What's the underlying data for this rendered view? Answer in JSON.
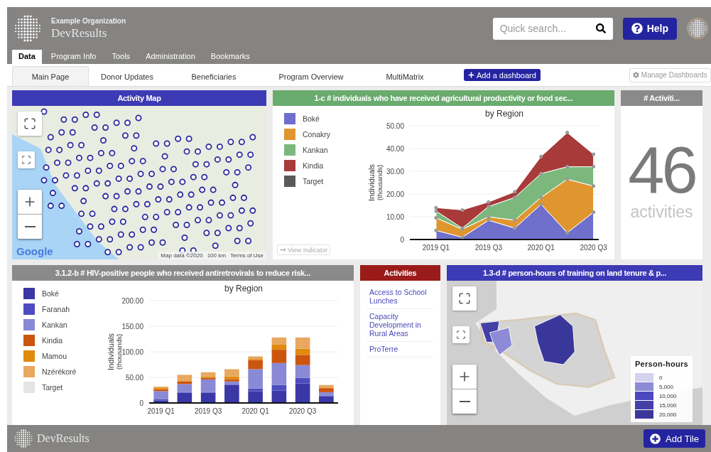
{
  "header": {
    "organization": "Example Organization",
    "app_name": "DevResults",
    "search": {
      "placeholder": "Quick search..."
    },
    "help_button": "Help"
  },
  "nav_tabs": [
    {
      "label": "Data",
      "selected": true
    },
    {
      "label": "Program Info",
      "selected": false
    },
    {
      "label": "Tools",
      "selected": false
    },
    {
      "label": "Administration",
      "selected": false
    },
    {
      "label": "Bookmarks",
      "selected": false
    }
  ],
  "dashboard_tabs": [
    {
      "label": "Main Page",
      "selected": true
    },
    {
      "label": "Donor Updates",
      "selected": false
    },
    {
      "label": "Beneficiaries",
      "selected": false
    },
    {
      "label": "Program Overview",
      "selected": false
    },
    {
      "label": "MultiMatrix",
      "selected": false
    }
  ],
  "add_dashboard_button": "Add a dashboard",
  "manage_dashboards_button": "Manage Dashboards",
  "rows": [
    {
      "tiles": [
        {
          "kind": "map",
          "title": "Activity Map",
          "color": "#3d3ab5",
          "logo": "Google",
          "attributions": [
            "Map data ©2020",
            "100 km",
            "Terms of Use"
          ]
        },
        {
          "kind": "chart",
          "title": "1-c # individuals who have received agricultural productivity or food sec...",
          "color": "#6aab6e",
          "view_indicator": "View Indicator",
          "chart_data": {
            "type": "area",
            "title": "by Region",
            "ylabel": "Individuals $_{(thousands)}$",
            "stacked": true,
            "grid": true,
            "categories": [
              "2019 Q1",
              null,
              "2019 Q3",
              null,
              "2020 Q1",
              null,
              "2020 Q3"
            ],
            "ylim": [
              0,
              50
            ],
            "yticks": [
              {
                "value": 0,
                "label": "0"
              },
              {
                "value": 10,
                "label": "10.00"
              },
              {
                "value": 20,
                "label": "20.00"
              },
              {
                "value": 30,
                "label": "30.00"
              },
              {
                "value": 40,
                "label": "40.00"
              },
              {
                "value": 50,
                "label": "50.00"
              }
            ],
            "series": [
              {
                "name": "Boké",
                "color": "#6f6fcc",
                "values": [
                  4,
                  1,
                  8.5,
                  5,
                  15.5,
                  3,
                  12
                ]
              },
              {
                "name": "Conakry",
                "color": "#e0962e",
                "values": [
                  5.5,
                  3.5,
                  1.5,
                  3.5,
                  3,
                  23.5,
                  11.5
                ]
              },
              {
                "name": "Kankan",
                "color": "#7cb87c",
                "values": [
                  3,
                  0.5,
                  4.5,
                  10,
                  10.5,
                  5.5,
                  8.5
                ]
              },
              {
                "name": "Kindia",
                "color": "#a83a3a",
                "values": [
                  1.5,
                  8,
                  2,
                  2.5,
                  7.5,
                  15,
                  5.5
                ]
              },
              {
                "name": "Target",
                "color": "#5a5a5a",
                "values": [
                  null,
                  null,
                  null,
                  null,
                  null,
                  null,
                  null
                ]
              }
            ]
          }
        },
        {
          "kind": "count",
          "title": "# Activiti...",
          "color": "#8a8a8a",
          "value": "46",
          "unit": "activities"
        }
      ]
    },
    {
      "tiles": [
        {
          "kind": "chart",
          "title": "3.1.2-b # HIV-positive people who received antiretrovirals to reduce risk...",
          "color": "#8a8a8a",
          "chart_data": {
            "type": "bar",
            "title": "by Region",
            "ylabel": "Individuals $_{(thousands)}$",
            "stacked": true,
            "grid": true,
            "categories": [
              "2019 Q1",
              null,
              "2019 Q3",
              null,
              "2020 Q1",
              null,
              "2020 Q3",
              null
            ],
            "ylim": [
              0,
              200
            ],
            "yticks": [
              {
                "value": 0,
                "label": "0"
              },
              {
                "value": 50,
                "label": "50.00"
              },
              {
                "value": 100,
                "label": "100.00"
              },
              {
                "value": 150,
                "label": "150.00"
              },
              {
                "value": 200,
                "label": "200.00"
              }
            ],
            "series": [
              {
                "name": "Boké",
                "color": "#3a37a6",
                "values": [
                  5,
                  20,
                  20,
                  35,
                  23,
                  24,
                  38,
                  13
                ]
              },
              {
                "name": "Faranah",
                "color": "#4d4cc0",
                "values": [
                  2,
                  1,
                  1,
                  1,
                  5,
                  11,
                  11,
                  1
                ]
              },
              {
                "name": "Kankan",
                "color": "#8a89d6",
                "values": [
                  16,
                  16,
                  25,
                  6,
                  38,
                  43,
                  25,
                  7
                ]
              },
              {
                "name": "Kindia",
                "color": "#cc550e",
                "values": [
                  4,
                  5,
                  3,
                  4,
                  18,
                  26,
                  20,
                  8
                ]
              },
              {
                "name": "Mamou",
                "color": "#e08a0f",
                "values": [
                  3,
                  1,
                  3,
                  6,
                  2,
                  10,
                  12,
                  0
                ]
              },
              {
                "name": "Nzérékoré",
                "color": "#e8a860",
                "values": [
                  2,
                  12,
                  8,
                  14,
                  5,
                  14,
                  22,
                  6
                ]
              },
              {
                "name": "Target",
                "color": "#e4e4e4",
                "values": [
                  null,
                  null,
                  null,
                  null,
                  null,
                  null,
                  null,
                  null
                ]
              }
            ]
          }
        },
        {
          "kind": "list",
          "title": "Activities",
          "color": "#9b1b1b",
          "items": [
            "Access to School Lunches",
            "Capacity Development in Rural Areas",
            "ProTerre"
          ]
        },
        {
          "kind": "choropleth",
          "title": "1.3-d # person-hours of training on land tenure & p...",
          "color": "#3d3ab5",
          "legend": {
            "title": "Person-hours",
            "items": [
              {
                "label": "0",
                "color": "#d4d3ef"
              },
              {
                "label": "5,000",
                "color": "#8d8bd6"
              },
              {
                "label": "10,000",
                "color": "#4c49c0"
              },
              {
                "label": "15,000",
                "color": "#4440a8"
              },
              {
                "label": "20,000",
                "color": "#3a379a"
              }
            ]
          }
        }
      ]
    }
  ],
  "footer": {
    "app_name": "DevResults",
    "add_tile_button": "Add Tile"
  }
}
